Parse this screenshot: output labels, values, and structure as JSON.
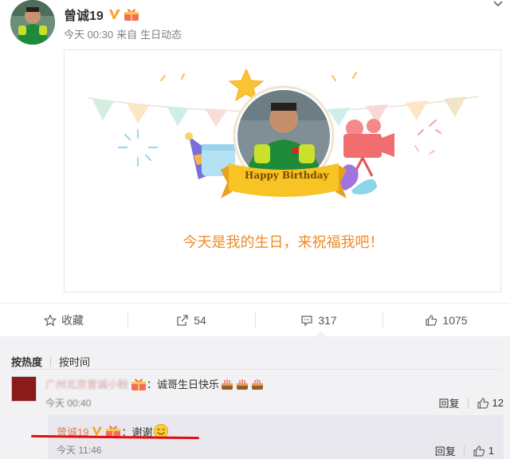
{
  "post": {
    "author": "曾诚19",
    "time": "今天 00:30",
    "source_prefix": "来自",
    "source": "生日动态",
    "card_banner": "Happy Birthday",
    "card_text": "今天是我的生日，来祝福我吧！"
  },
  "actions": {
    "favorite": "收藏",
    "repost_count": "54",
    "comment_count": "317",
    "like_count": "1075"
  },
  "comments": {
    "sort_hot": "按热度",
    "sort_time": "按时间",
    "items": [
      {
        "name": "广州北京曾诚小粉",
        "text": "：诚哥生日快乐",
        "time": "今天 00:40",
        "reply_label": "回复",
        "likes": "12"
      }
    ],
    "reply": {
      "name": "曾诚19",
      "text": "：谢谢",
      "time": "今天 11:46",
      "reply_label": "回复",
      "likes": "1"
    }
  },
  "colors": {
    "accent_orange": "#f08a24",
    "link_orange": "#eb7350",
    "verified_yellow": "#f5a623",
    "highlight_red": "#e01010"
  },
  "icons": [
    "chevron-down-icon",
    "verified-icon",
    "birthday-badge-icon",
    "star-icon",
    "repost-icon",
    "comment-icon",
    "like-icon",
    "cake-icon",
    "smile-emoji-icon"
  ]
}
